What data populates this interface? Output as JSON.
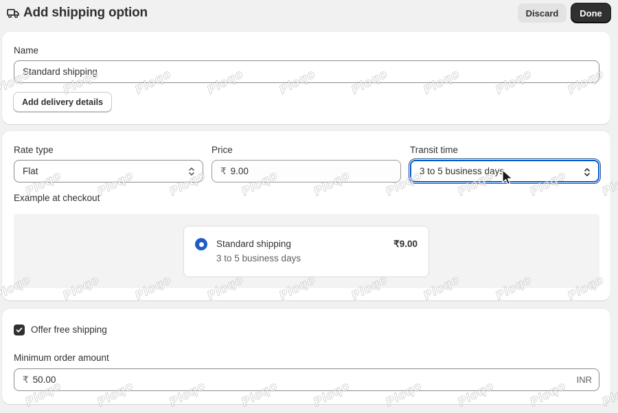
{
  "header": {
    "title": "Add shipping option",
    "icon": "truck-icon",
    "discard_label": "Discard",
    "done_label": "Done"
  },
  "name_section": {
    "label": "Name",
    "value": "Standard shipping",
    "add_details_label": "Add delivery details"
  },
  "rate_section": {
    "rate_type_label": "Rate type",
    "rate_type_value": "Flat",
    "price_label": "Price",
    "price_prefix": "₹",
    "price_value": "9.00",
    "transit_label": "Transit time",
    "transit_value": "3 to 5 business days",
    "example_label": "Example at checkout",
    "preview": {
      "name": "Standard shipping",
      "time": "3 to 5 business days",
      "price": "₹9.00"
    }
  },
  "free_shipping": {
    "checkbox_label": "Offer free shipping",
    "checked": true,
    "min_label": "Minimum order amount",
    "min_prefix": "₹",
    "min_value": "50.00",
    "currency": "INR"
  },
  "watermark_text": "Ploqo",
  "colors": {
    "accent": "#005bd3",
    "primary_button": "#303030",
    "radio": "#1f5dc6"
  }
}
